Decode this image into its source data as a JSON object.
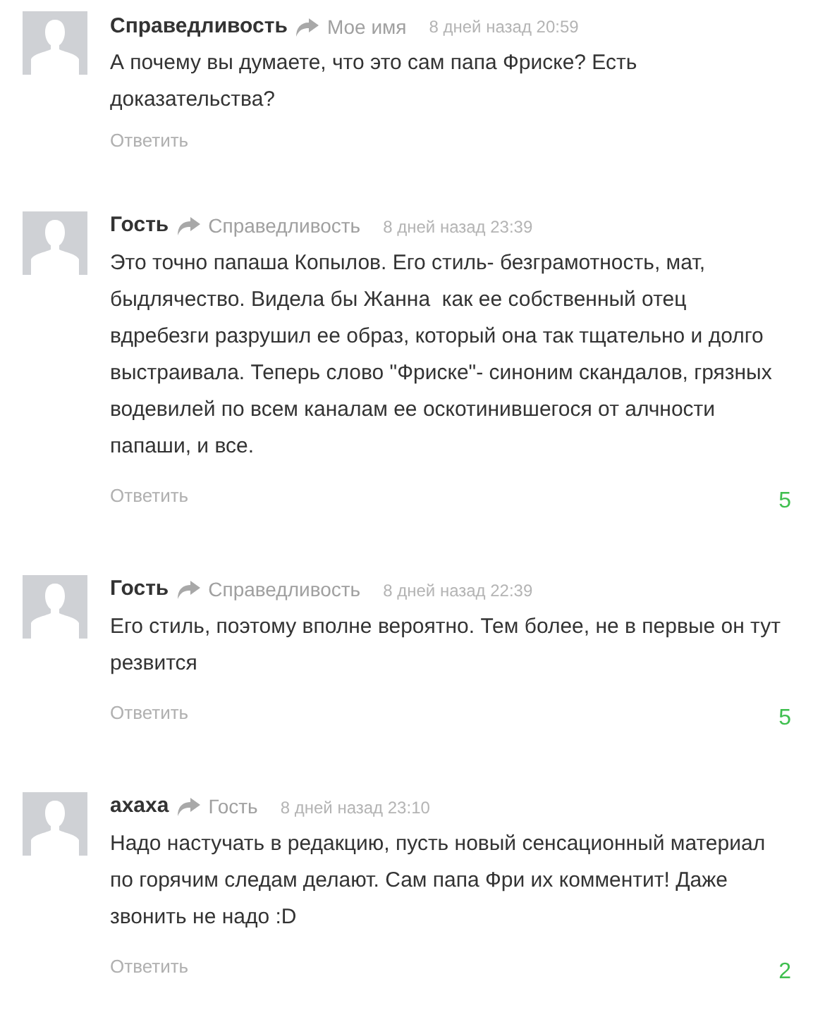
{
  "comments": [
    {
      "author": "Справедливость",
      "reply_to": "Мое имя",
      "time": "8 дней назад 20:59",
      "text": "А почему вы думаете, что это сам папа Фриске? Есть доказательства?",
      "reply": "Ответить"
    },
    {
      "author": "Гость",
      "reply_to": "Справедливость",
      "time": "8 дней назад 23:39",
      "text": "Это точно папаша Копылов. Его стиль- безграмотность, мат, быдлячество. Видела бы Жанна  как ее собственный отец вдребезги разрушил ее образ, который она так тщательно и долго выстраивала. Теперь слово \"Фриске\"- синоним скандалов, грязных водевилей по всем каналам ее оскотинившегося от алчности папаши, и все.",
      "reply": "Ответить",
      "score": "5"
    },
    {
      "author": "Гость",
      "reply_to": "Справедливость",
      "time": "8 дней назад 22:39",
      "text": "Его стиль, поэтому вполне вероятно. Тем более, не в первые он тут резвится",
      "reply": "Ответить",
      "score": "5"
    },
    {
      "author": "ахаха",
      "reply_to": "Гость",
      "time": "8 дней назад 23:10",
      "text": "Надо настучать в редакцию, пусть новый сенсационный материал по горячим следам делают. Сам папа Фри их комментит! Даже звонить не надо :D",
      "reply": "Ответить",
      "score": "2"
    }
  ]
}
